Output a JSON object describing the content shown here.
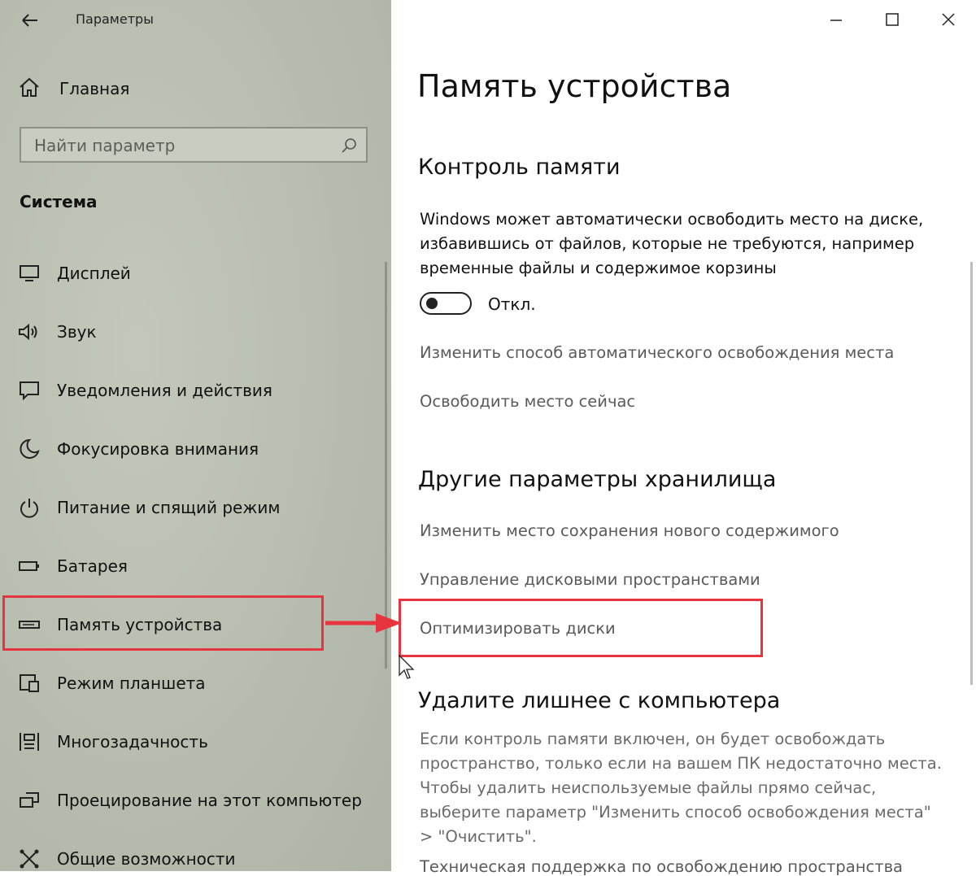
{
  "window": {
    "title": "Параметры",
    "controls": [
      "minimize",
      "maximize",
      "close"
    ]
  },
  "sidebar": {
    "home_label": "Главная",
    "search_placeholder": "Найти параметр",
    "section_title": "Система",
    "items": [
      {
        "label": "Дисплей",
        "icon": "display-icon"
      },
      {
        "label": "Звук",
        "icon": "speaker-icon"
      },
      {
        "label": "Уведомления и действия",
        "icon": "notification-icon"
      },
      {
        "label": "Фокусировка внимания",
        "icon": "moon-icon"
      },
      {
        "label": "Питание и спящий режим",
        "icon": "power-icon"
      },
      {
        "label": "Батарея",
        "icon": "battery-icon"
      },
      {
        "label": "Память устройства",
        "icon": "storage-icon",
        "selected": true
      },
      {
        "label": "Режим планшета",
        "icon": "tablet-mode-icon"
      },
      {
        "label": "Многозадачность",
        "icon": "multitasking-icon"
      },
      {
        "label": "Проецирование на этот компьютер",
        "icon": "projecting-icon"
      },
      {
        "label": "Общие возможности",
        "icon": "shared-experiences-icon"
      }
    ]
  },
  "main": {
    "title": "Память устройства",
    "storage_sense": {
      "heading": "Контроль памяти",
      "description": "Windows может автоматически освободить место на диске, избавившись от файлов, которые не требуются, например временные файлы и содержимое корзины",
      "toggle_label": "Откл.",
      "toggle_on": false,
      "link_change": "Изменить способ автоматического освобождения места",
      "link_free_now": "Освободить место сейчас"
    },
    "other_storage": {
      "heading": "Другие параметры хранилища",
      "link_save_location": "Изменить место сохранения нового содержимого",
      "link_manage_spaces": "Управление дисковыми пространствами",
      "link_optimize": "Оптимизировать диски"
    },
    "cleanup": {
      "heading": "Удалите лишнее с компьютера",
      "description": "Если контроль памяти включен, он будет освобождать пространство, только если на вашем ПК недостаточно места. Чтобы удалить неиспользуемые файлы прямо сейчас, выберите параметр \"Изменить способ освобождения места\" > \"Очистить\".",
      "support_text": "Техническая поддержка по освобождению пространства"
    }
  },
  "colors": {
    "sidebar_bg": "#b9bfb1",
    "highlight": "#e8343e",
    "link_gray": "#5a5a5a"
  }
}
